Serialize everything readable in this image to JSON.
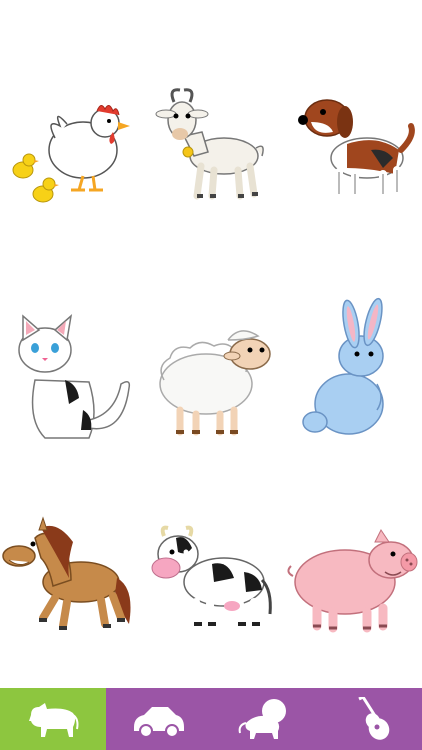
{
  "grid": {
    "animals": [
      "chicks-and-hen",
      "goat",
      "dog",
      "cat",
      "sheep",
      "rabbit",
      "horse",
      "cow",
      "pig"
    ]
  },
  "tabbar": {
    "tabs": [
      {
        "icon": "farm-animal-icon",
        "active": true
      },
      {
        "icon": "car-icon",
        "active": false
      },
      {
        "icon": "lion-icon",
        "active": false
      },
      {
        "icon": "guitar-icon",
        "active": false
      }
    ],
    "colors": {
      "bar": "#9b55a6",
      "active": "#8dc63f",
      "icon": "#ffffff"
    }
  }
}
